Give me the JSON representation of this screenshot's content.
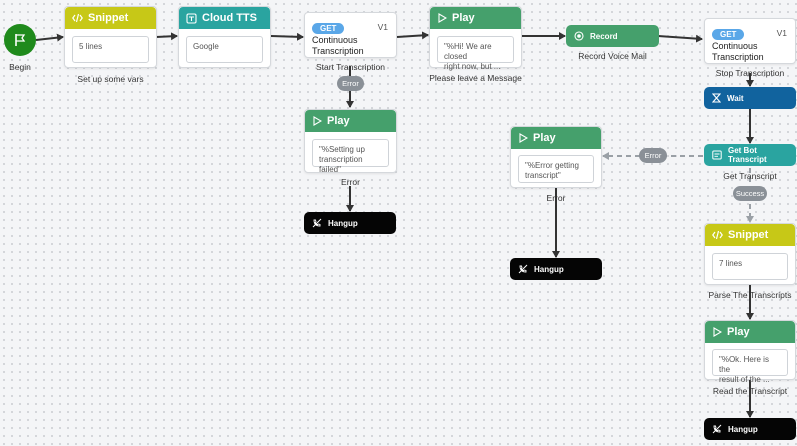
{
  "begin": {
    "label": "Begin"
  },
  "snippet1": {
    "title": "Snippet",
    "body": "5 lines",
    "caption": "Set up some vars"
  },
  "tts": {
    "title": "Cloud TTS",
    "body": "Google"
  },
  "get1": {
    "method": "GET",
    "version": "V1",
    "title_l1": "Continuous",
    "title_l2": "Transcription",
    "caption": "Start Transcription"
  },
  "badge_error1": {
    "text": "Error"
  },
  "play1": {
    "title": "Play",
    "body_l1": "\"%Hi! We are closed",
    "body_l2": "right now, but ...",
    "caption": "Please leave a Message"
  },
  "record": {
    "title": "Record",
    "caption": "Record Voice Mail"
  },
  "get2": {
    "method": "GET",
    "version": "V1",
    "title_l1": "Continuous",
    "title_l2": "Transcription",
    "caption": "Stop Transcription"
  },
  "wait": {
    "title": "Wait"
  },
  "play_err1": {
    "title": "Play",
    "body_l1": "\"%Setting up",
    "body_l2": "transcription failed\"",
    "caption": "Error"
  },
  "hangup1": {
    "title": "Hangup"
  },
  "play_err2": {
    "title": "Play",
    "body_l1": "\"%Error getting",
    "body_l2": "transcript\"",
    "caption": "Error"
  },
  "hangup2": {
    "title": "Hangup"
  },
  "badge_error2": {
    "text": "Error"
  },
  "botx": {
    "title": "Get Bot Transcript",
    "caption": "Get Transcript"
  },
  "badge_success": {
    "text": "Success"
  },
  "snippet2": {
    "title": "Snippet",
    "body": "7 lines",
    "caption": "Parse The Transcripts"
  },
  "play3": {
    "title": "Play",
    "body_l1": "\"%Ok. Here is the",
    "body_l2": "result of the ...",
    "caption": "Read the Transcript"
  },
  "hangup3": {
    "title": "Hangup"
  },
  "colors": {
    "begin": "#1f8a1c",
    "snippet": "#c7c817",
    "tts": "#2aa4a0",
    "play": "#45a06c",
    "wait": "#11639e",
    "hangup": "#050505",
    "get": "#5aa7e8",
    "badge": "#8a9097"
  }
}
